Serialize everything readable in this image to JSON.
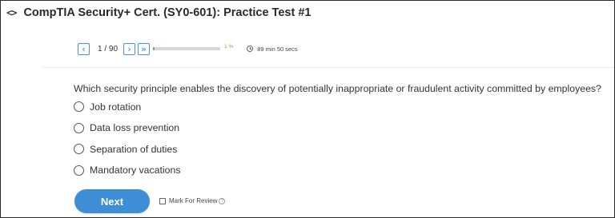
{
  "header": {
    "icon": "code-icon",
    "icon_glyph": "<>",
    "title": "CompTIA Security+ Cert. (SY0-601): Practice Test #1"
  },
  "toolbar": {
    "prev_icon": "chevron-left-icon",
    "prev_glyph": "‹",
    "page_counter": "1 / 90",
    "next_icon": "chevron-right-icon",
    "next_glyph": "›",
    "last_icon": "double-chevron-right-icon",
    "last_glyph": "»",
    "progress_percent": 1,
    "progress_label": "1 %",
    "progress_color": "#6db33f",
    "timer_icon": "clock-icon",
    "timer_text": "89 min 50 secs"
  },
  "question": {
    "text": "Which security principle enables the discovery of potentially inappropriate or fraudulent activity committed by employees?",
    "options": [
      {
        "label": "Job rotation",
        "selected": false
      },
      {
        "label": "Data loss prevention",
        "selected": false
      },
      {
        "label": "Separation of duties",
        "selected": false
      },
      {
        "label": "Mandatory vacations",
        "selected": false
      }
    ]
  },
  "footer": {
    "next_label": "Next",
    "next_color": "#3d8ed6",
    "review_label": "Mark For Review",
    "review_checked": false,
    "info_icon": "info-icon",
    "info_glyph": "?"
  }
}
